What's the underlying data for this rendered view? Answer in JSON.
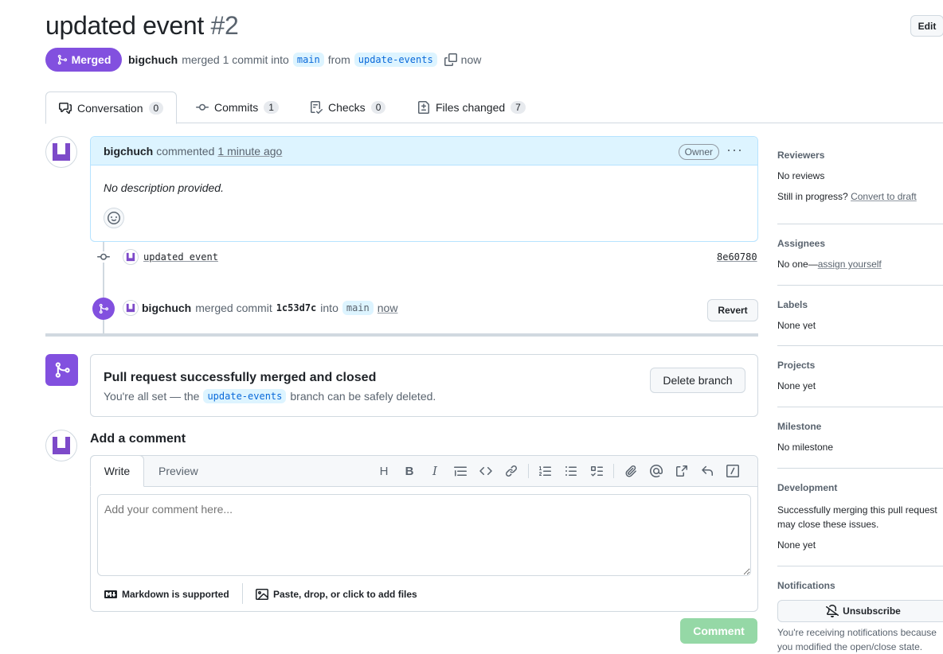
{
  "pr": {
    "title": "updated event",
    "number": "#2",
    "edit_label": "Edit",
    "state_label": "Merged",
    "author": "bigchuch",
    "merge_text": "merged 1 commit into",
    "base_branch": "main",
    "from_text": "from",
    "head_branch": "update-events",
    "time": "now"
  },
  "tabs": [
    {
      "label": "Conversation",
      "count": "0"
    },
    {
      "label": "Commits",
      "count": "1"
    },
    {
      "label": "Checks",
      "count": "0"
    },
    {
      "label": "Files changed",
      "count": "7"
    }
  ],
  "comment": {
    "author": "bigchuch",
    "action": "commented",
    "time": "1 minute ago",
    "role": "Owner",
    "body": "No description provided."
  },
  "commit_event": {
    "message": "updated event",
    "sha": "8e60780"
  },
  "merge_event": {
    "author": "bigchuch",
    "text1": "merged commit",
    "sha": "1c53d7c",
    "text2": "into",
    "branch": "main",
    "time": "now",
    "revert_label": "Revert"
  },
  "merged_box": {
    "heading": "Pull request successfully merged and closed",
    "text_before": "You're all set — the",
    "branch": "update-events",
    "text_after": "branch can be safely deleted.",
    "delete_label": "Delete branch"
  },
  "add_comment": {
    "heading": "Add a comment",
    "write_tab": "Write",
    "preview_tab": "Preview",
    "placeholder": "Add your comment here...",
    "markdown_note": "Markdown is supported",
    "attach_note": "Paste, drop, or click to add files",
    "submit_label": "Comment"
  },
  "sidebar": {
    "reviewers": {
      "heading": "Reviewers",
      "value": "No reviews",
      "progress_text": "Still in progress?",
      "draft_link": "Convert to draft"
    },
    "assignees": {
      "heading": "Assignees",
      "value_prefix": "No one—",
      "link": "assign yourself"
    },
    "labels": {
      "heading": "Labels",
      "value": "None yet"
    },
    "projects": {
      "heading": "Projects",
      "value": "None yet"
    },
    "milestone": {
      "heading": "Milestone",
      "value": "No milestone"
    },
    "development": {
      "heading": "Development",
      "text": "Successfully merging this pull request may close these issues.",
      "value": "None yet"
    },
    "notifications": {
      "heading": "Notifications",
      "button": "Unsubscribe",
      "text": "You're receiving notifications because you modified the open/close state."
    }
  },
  "colors": {
    "merged_purple": "#8250df",
    "link_blue": "#0969da",
    "comment_green": "#1f883d"
  }
}
